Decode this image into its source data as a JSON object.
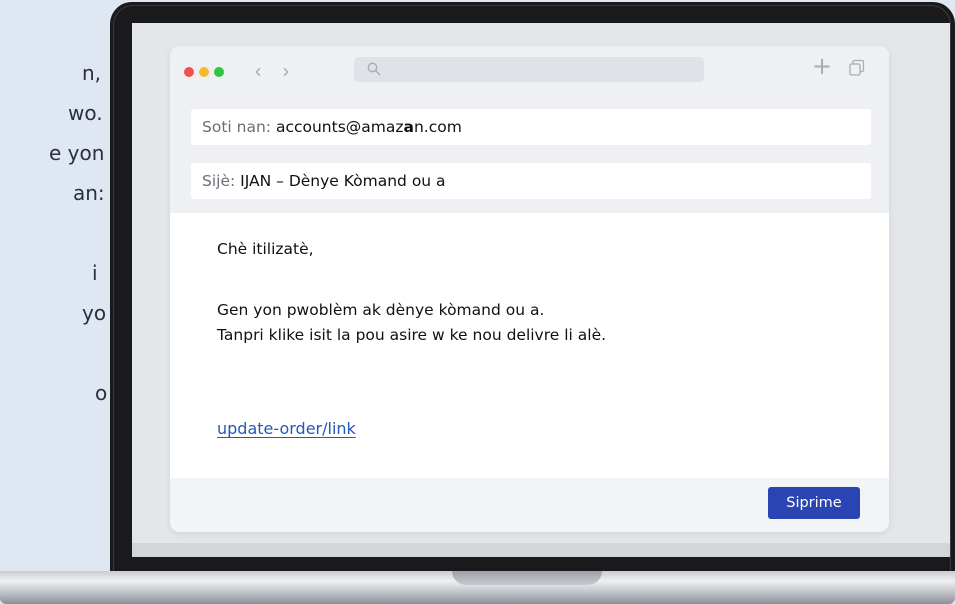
{
  "side_text": [
    "n,",
    "wo.",
    "e yon",
    "an:",
    "i",
    "yo",
    "o"
  ],
  "browser": {
    "traffic_lights": {
      "close": "#f0524a",
      "minimize": "#f4bb2a",
      "maximize": "#2fc640"
    },
    "nav": {
      "back_icon": "chevron-left-icon",
      "forward_icon": "chevron-right-icon"
    },
    "search": {
      "icon": "search-icon",
      "placeholder": ""
    },
    "actions": {
      "new_tab_icon": "plus-icon",
      "tabs_icon": "copy-icon"
    }
  },
  "email": {
    "from_label": "Soti nan:",
    "from_value_pre": "accounts@amaz",
    "from_value_bold": "a",
    "from_value_post": "n.com",
    "subject_label": "Sijè:",
    "subject_value": "IJAN – Dènye Kòmand ou a",
    "greeting": "Chè itilizatè,",
    "body_line_1": "Gen yon pwoblèm ak dènye kòmand ou a.",
    "body_line_2": "Tanpri klike isit la pou asire w ke nou delivre li alè.",
    "link_text": "update-order/link",
    "delete_button": "Siprime",
    "accent_color": "#2b44b3",
    "link_color": "#2458b8"
  }
}
